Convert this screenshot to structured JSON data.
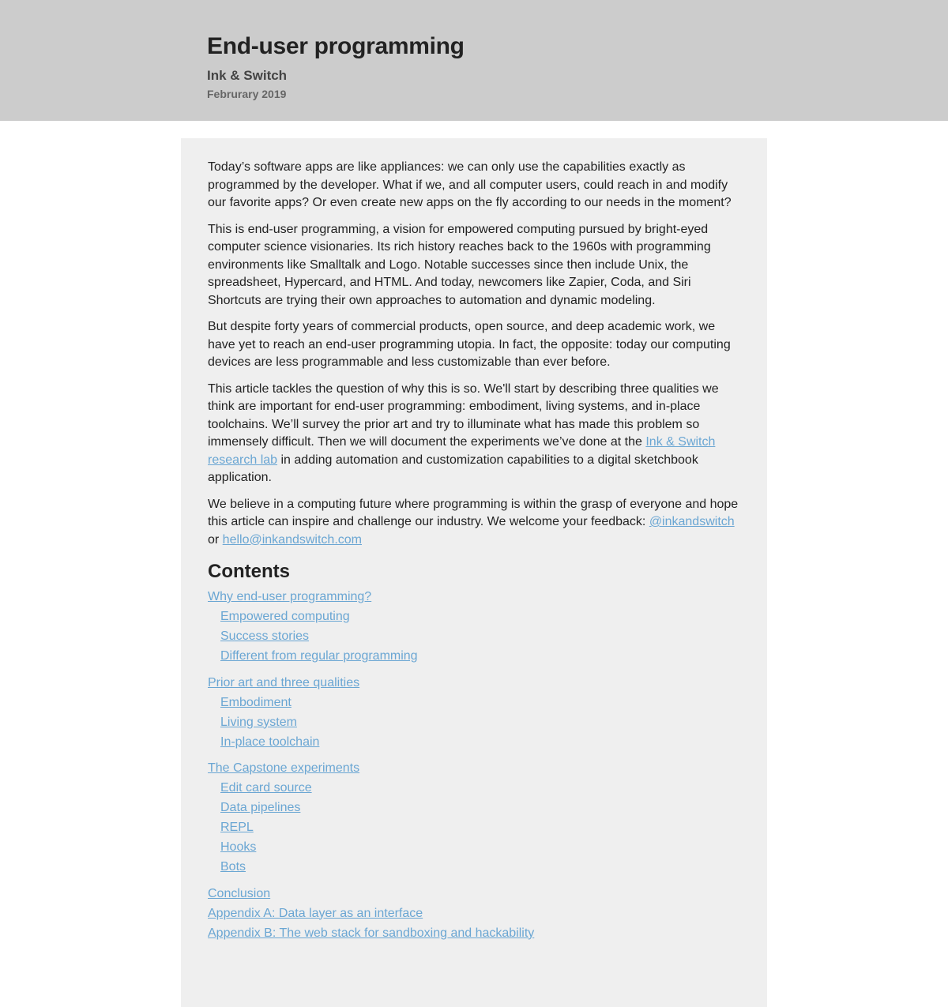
{
  "header": {
    "title": "End-user programming",
    "author": "Ink & Switch",
    "date": "Februrary 2019"
  },
  "colors": {
    "header_bg": "#cccccc",
    "panel_bg": "#efefef",
    "link": "#6aa6d3",
    "text": "#222222"
  },
  "intro": {
    "p1": "Today’s software apps are like appliances: we can only use the capabilities exactly as programmed by the developer. What if we, and all computer users, could reach in and modify our favorite apps? Or even create new apps on the fly according to our needs in the moment?",
    "p2": "This is end-user programming, a vision for empowered computing pursued by bright-eyed computer science visionaries. Its rich history reaches back to the 1960s with programming environments like Smalltalk and Logo. Notable successes since then include Unix, the spreadsheet, Hypercard, and HTML. And today, newcomers like Zapier, Coda, and Siri Shortcuts are trying their own approaches to automation and dynamic modeling.",
    "p3": "But despite forty years of commercial products, open source, and deep academic work, we have yet to reach an end-user programming utopia. In fact, the opposite: today our computing devices are less programmable and less customizable than ever before.",
    "p4_before": "This article tackles the question of why this is so. We'll start by describing three qualities we think are important for end-user programming: embodiment, living systems, and in-place toolchains. We’ll survey the prior art and try to illuminate what has made this problem so immensely difficult. Then we will document the experiments we’ve done at the ",
    "p4_link": "Ink & Switch research lab",
    "p4_after": " in adding automation and customization capabilities to a digital sketchbook application.",
    "p5_before": "We believe in a computing future where programming is within the grasp of everyone and hope this article can inspire and challenge our industry. We welcome your feedback: ",
    "p5_link1": "@inkandswitch",
    "p5_middle": " or ",
    "p5_link2": "hello@inkandswitch.com"
  },
  "contents": {
    "heading": "Contents",
    "sections": [
      {
        "label": "Why end-user programming?",
        "children": [
          "Empowered computing",
          "Success stories",
          "Different from regular programming"
        ]
      },
      {
        "label": "Prior art and three qualities",
        "children": [
          "Embodiment",
          "Living system",
          "In-place toolchain"
        ]
      },
      {
        "label": "The Capstone experiments",
        "children": [
          "Edit card source",
          "Data pipelines",
          "REPL",
          "Hooks",
          "Bots"
        ]
      },
      {
        "label": "Conclusion"
      },
      {
        "label": "Appendix A: Data layer as an interface"
      },
      {
        "label": "Appendix B: The web stack for sandboxing and hackability"
      }
    ]
  }
}
